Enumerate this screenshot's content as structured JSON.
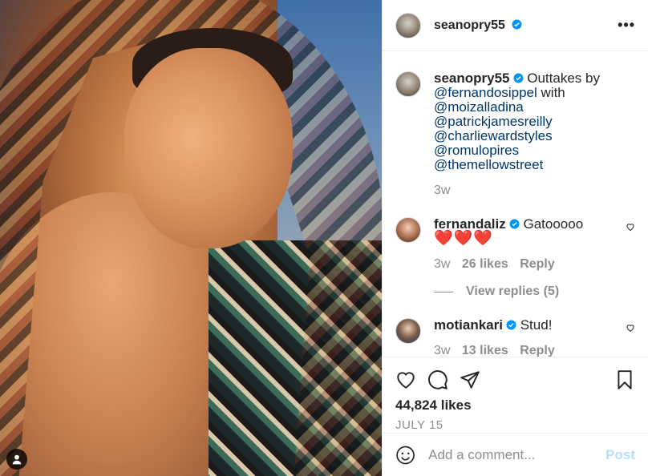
{
  "post": {
    "owner": {
      "username": "seanopry55",
      "verified": true
    },
    "more_label": "•••"
  },
  "comments": [
    {
      "username": "seanopry55",
      "text": "Outtakes by",
      "mentions": [
        "@fernandosippel",
        "with",
        "@moizalladina",
        "@patrickjamesreilly",
        "@charliewardstyles",
        "@romulopires",
        "@themellowstreet"
      ],
      "time": "3w"
    },
    {
      "username": "fernandaliz",
      "text": "Gatooooo",
      "emoji": "❤️❤️❤️",
      "time": "3w",
      "likes": "26 likes",
      "reply": "Reply",
      "view_replies": "View replies (5)"
    },
    {
      "username": "motiankari",
      "text": "Stud!",
      "time": "3w",
      "likes": "13 likes",
      "reply": "Reply"
    }
  ],
  "actions": {
    "likes": "44,824 likes",
    "date": "JULY 15"
  },
  "comment_box": {
    "placeholder": "Add a comment...",
    "post_label": "Post"
  },
  "colors": {
    "accent": "#0095f6",
    "mention": "#00376b",
    "muted": "#8e8e8e",
    "post_disabled": "#b2dffc"
  }
}
